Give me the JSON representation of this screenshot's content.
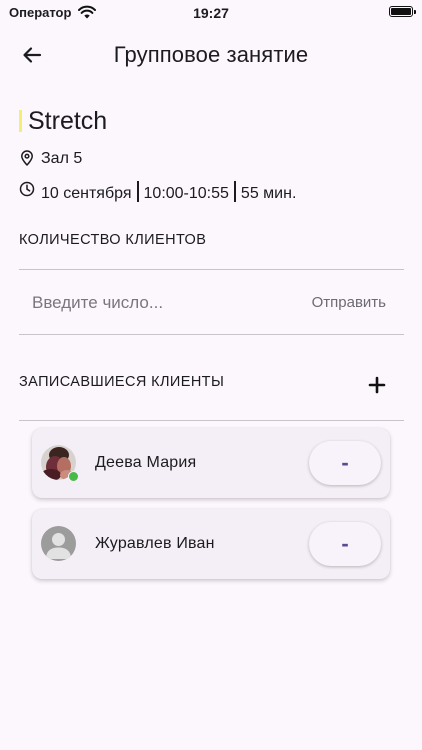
{
  "status_bar": {
    "carrier": "Оператор",
    "time": "19:27"
  },
  "header": {
    "title": "Групповое занятие"
  },
  "class_info": {
    "name": "Stretch",
    "location": "Зал 5",
    "date": "10 сентября",
    "time_range": "10:00-10:55",
    "duration": "55 мин."
  },
  "client_count": {
    "label": "КОЛИЧЕСТВО КЛИЕНТОВ",
    "placeholder": "Введите число...",
    "value": "",
    "submit_label": "Отправить"
  },
  "enrolled": {
    "label": "ЗАПИСАВШИЕСЯ КЛИЕНТЫ",
    "add_label": "+",
    "clients": [
      {
        "name": "Деева Мария",
        "remove_label": "-",
        "online": true
      },
      {
        "name": "Журавлев Иван",
        "remove_label": "-",
        "online": false
      }
    ]
  },
  "colors": {
    "accent": "#f4ee74",
    "background": "#fcf6fd",
    "online": "#49b947",
    "remove_button_text": "#5b4a8f"
  }
}
